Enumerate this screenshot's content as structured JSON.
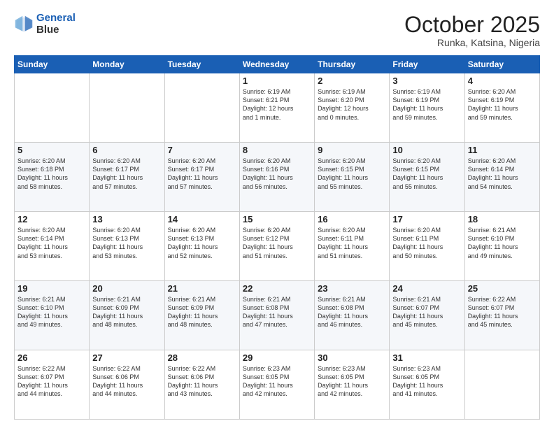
{
  "header": {
    "logo_line1": "General",
    "logo_line2": "Blue",
    "month": "October 2025",
    "location": "Runka, Katsina, Nigeria"
  },
  "weekdays": [
    "Sunday",
    "Monday",
    "Tuesday",
    "Wednesday",
    "Thursday",
    "Friday",
    "Saturday"
  ],
  "weeks": [
    [
      {
        "day": "",
        "info": ""
      },
      {
        "day": "",
        "info": ""
      },
      {
        "day": "",
        "info": ""
      },
      {
        "day": "1",
        "info": "Sunrise: 6:19 AM\nSunset: 6:21 PM\nDaylight: 12 hours\nand 1 minute."
      },
      {
        "day": "2",
        "info": "Sunrise: 6:19 AM\nSunset: 6:20 PM\nDaylight: 12 hours\nand 0 minutes."
      },
      {
        "day": "3",
        "info": "Sunrise: 6:19 AM\nSunset: 6:19 PM\nDaylight: 11 hours\nand 59 minutes."
      },
      {
        "day": "4",
        "info": "Sunrise: 6:20 AM\nSunset: 6:19 PM\nDaylight: 11 hours\nand 59 minutes."
      }
    ],
    [
      {
        "day": "5",
        "info": "Sunrise: 6:20 AM\nSunset: 6:18 PM\nDaylight: 11 hours\nand 58 minutes."
      },
      {
        "day": "6",
        "info": "Sunrise: 6:20 AM\nSunset: 6:17 PM\nDaylight: 11 hours\nand 57 minutes."
      },
      {
        "day": "7",
        "info": "Sunrise: 6:20 AM\nSunset: 6:17 PM\nDaylight: 11 hours\nand 57 minutes."
      },
      {
        "day": "8",
        "info": "Sunrise: 6:20 AM\nSunset: 6:16 PM\nDaylight: 11 hours\nand 56 minutes."
      },
      {
        "day": "9",
        "info": "Sunrise: 6:20 AM\nSunset: 6:15 PM\nDaylight: 11 hours\nand 55 minutes."
      },
      {
        "day": "10",
        "info": "Sunrise: 6:20 AM\nSunset: 6:15 PM\nDaylight: 11 hours\nand 55 minutes."
      },
      {
        "day": "11",
        "info": "Sunrise: 6:20 AM\nSunset: 6:14 PM\nDaylight: 11 hours\nand 54 minutes."
      }
    ],
    [
      {
        "day": "12",
        "info": "Sunrise: 6:20 AM\nSunset: 6:14 PM\nDaylight: 11 hours\nand 53 minutes."
      },
      {
        "day": "13",
        "info": "Sunrise: 6:20 AM\nSunset: 6:13 PM\nDaylight: 11 hours\nand 53 minutes."
      },
      {
        "day": "14",
        "info": "Sunrise: 6:20 AM\nSunset: 6:13 PM\nDaylight: 11 hours\nand 52 minutes."
      },
      {
        "day": "15",
        "info": "Sunrise: 6:20 AM\nSunset: 6:12 PM\nDaylight: 11 hours\nand 51 minutes."
      },
      {
        "day": "16",
        "info": "Sunrise: 6:20 AM\nSunset: 6:11 PM\nDaylight: 11 hours\nand 51 minutes."
      },
      {
        "day": "17",
        "info": "Sunrise: 6:20 AM\nSunset: 6:11 PM\nDaylight: 11 hours\nand 50 minutes."
      },
      {
        "day": "18",
        "info": "Sunrise: 6:21 AM\nSunset: 6:10 PM\nDaylight: 11 hours\nand 49 minutes."
      }
    ],
    [
      {
        "day": "19",
        "info": "Sunrise: 6:21 AM\nSunset: 6:10 PM\nDaylight: 11 hours\nand 49 minutes."
      },
      {
        "day": "20",
        "info": "Sunrise: 6:21 AM\nSunset: 6:09 PM\nDaylight: 11 hours\nand 48 minutes."
      },
      {
        "day": "21",
        "info": "Sunrise: 6:21 AM\nSunset: 6:09 PM\nDaylight: 11 hours\nand 48 minutes."
      },
      {
        "day": "22",
        "info": "Sunrise: 6:21 AM\nSunset: 6:08 PM\nDaylight: 11 hours\nand 47 minutes."
      },
      {
        "day": "23",
        "info": "Sunrise: 6:21 AM\nSunset: 6:08 PM\nDaylight: 11 hours\nand 46 minutes."
      },
      {
        "day": "24",
        "info": "Sunrise: 6:21 AM\nSunset: 6:07 PM\nDaylight: 11 hours\nand 45 minutes."
      },
      {
        "day": "25",
        "info": "Sunrise: 6:22 AM\nSunset: 6:07 PM\nDaylight: 11 hours\nand 45 minutes."
      }
    ],
    [
      {
        "day": "26",
        "info": "Sunrise: 6:22 AM\nSunset: 6:07 PM\nDaylight: 11 hours\nand 44 minutes."
      },
      {
        "day": "27",
        "info": "Sunrise: 6:22 AM\nSunset: 6:06 PM\nDaylight: 11 hours\nand 44 minutes."
      },
      {
        "day": "28",
        "info": "Sunrise: 6:22 AM\nSunset: 6:06 PM\nDaylight: 11 hours\nand 43 minutes."
      },
      {
        "day": "29",
        "info": "Sunrise: 6:23 AM\nSunset: 6:05 PM\nDaylight: 11 hours\nand 42 minutes."
      },
      {
        "day": "30",
        "info": "Sunrise: 6:23 AM\nSunset: 6:05 PM\nDaylight: 11 hours\nand 42 minutes."
      },
      {
        "day": "31",
        "info": "Sunrise: 6:23 AM\nSunset: 6:05 PM\nDaylight: 11 hours\nand 41 minutes."
      },
      {
        "day": "",
        "info": ""
      }
    ]
  ]
}
